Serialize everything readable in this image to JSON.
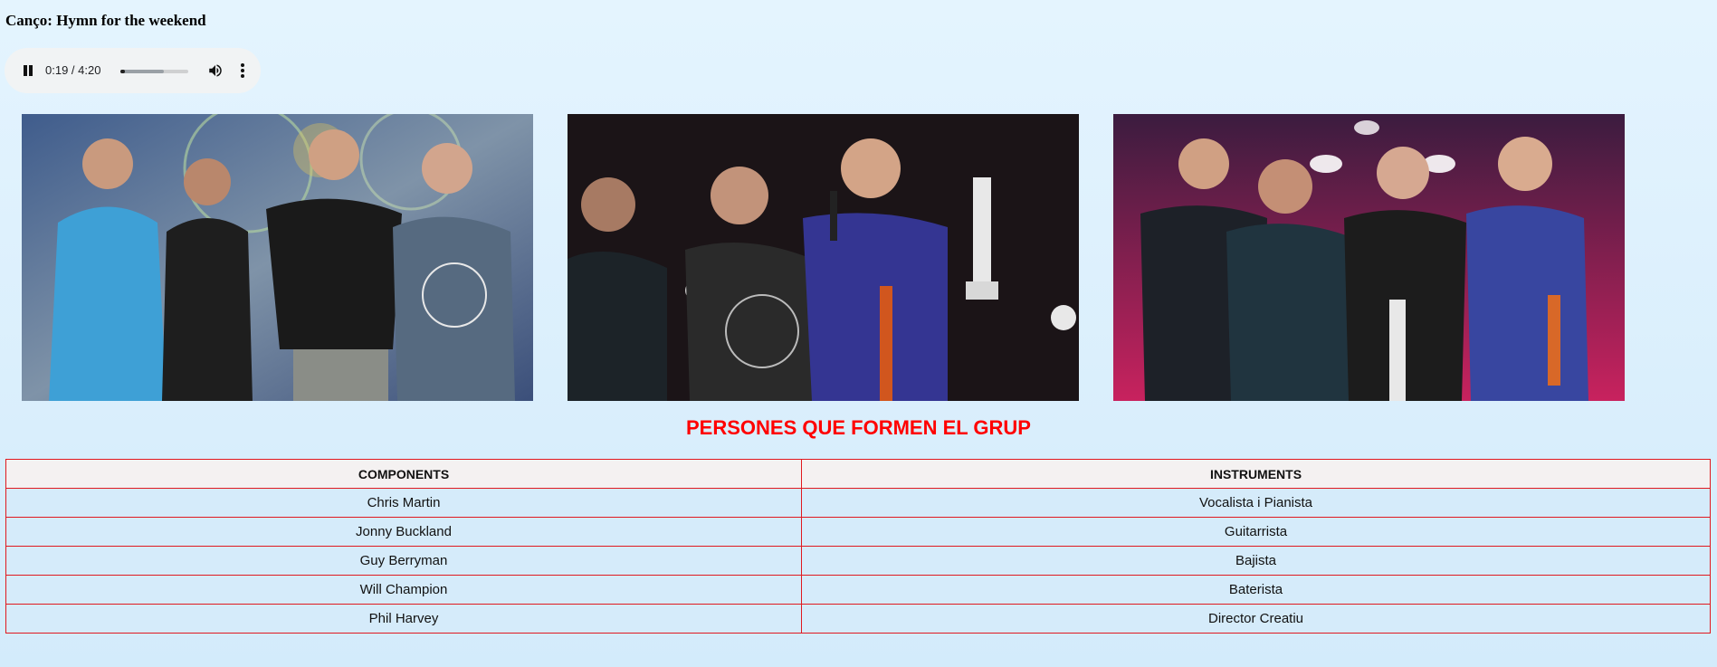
{
  "song": {
    "title": "Canço: Hymn for the weekend"
  },
  "audio_player": {
    "time": "0:19 / 4:20",
    "progress_fraction": 0.073,
    "pause_icon": "pause-icon",
    "volume_icon": "volume-icon",
    "menu_icon": "more-vertical-icon"
  },
  "photos": [
    {
      "icon": "band-photo-stage"
    },
    {
      "icon": "band-photo-award"
    },
    {
      "icon": "band-photo-award-2"
    }
  ],
  "section": {
    "title": "PERSONES QUE FORMEN EL GRUP",
    "color": "#ff0000"
  },
  "table": {
    "headers": [
      "COMPONENTS",
      "INSTRUMENTS"
    ],
    "rows": [
      [
        "Chris Martin",
        "Vocalista i Pianista"
      ],
      [
        "Jonny Buckland",
        "Guitarrista"
      ],
      [
        "Guy Berryman",
        "Bajista"
      ],
      [
        "Will Champion",
        "Baterista"
      ],
      [
        "Phil Harvey",
        "Director Creatiu"
      ]
    ],
    "border_color": "#e0191f"
  }
}
